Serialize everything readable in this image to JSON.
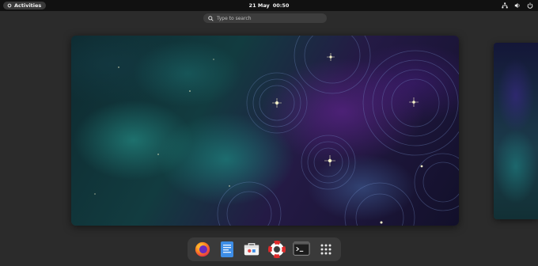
{
  "topbar": {
    "activities_label": "Activities",
    "date": "21 May",
    "time": "00:50",
    "tray_icons": [
      "network-icon",
      "volume-icon",
      "power-icon"
    ]
  },
  "search": {
    "placeholder": "Type to search"
  },
  "workspaces": [
    {
      "name": "workspace-1",
      "active": true
    },
    {
      "name": "workspace-2",
      "active": false
    }
  ],
  "dock": {
    "apps": [
      "firefox",
      "text-editor",
      "software-center",
      "help",
      "terminal",
      "show-apps"
    ]
  },
  "colors": {
    "topbar": "#111111",
    "background": "#2b2b2b",
    "dock": "#3a3a3a",
    "search": "#3d3d3d"
  }
}
